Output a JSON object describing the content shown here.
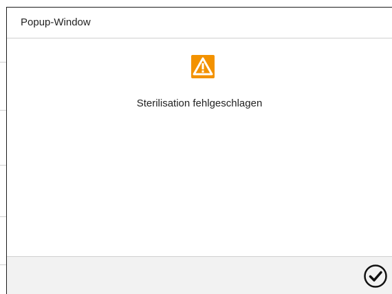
{
  "window": {
    "title": "Popup-Window"
  },
  "alert": {
    "icon": "warning-triangle-icon",
    "icon_color": "#f39200",
    "message": "Sterilisation fehlgeschlagen"
  },
  "footer": {
    "confirm_icon": "checkmark-circle-icon"
  }
}
